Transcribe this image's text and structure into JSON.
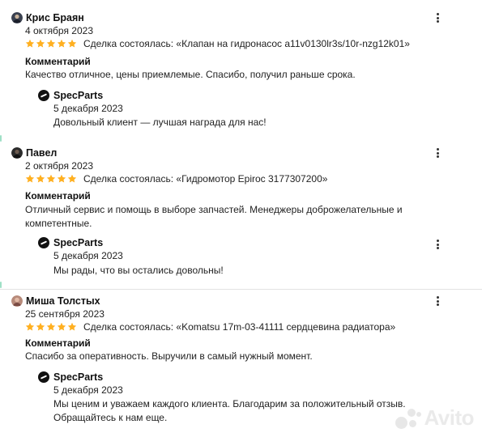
{
  "reviews": [
    {
      "author": "Крис Браян",
      "date": "4 октября 2023",
      "rating": 5,
      "deal": "Сделка состоялась: «Клапан на гидронасос а11v0130lr3s/10r-nzg12k01»",
      "comment_label": "Комментарий",
      "comment": "Качество отличное, цены приемлемые. Спасибо, получил раньше срока.",
      "reply": {
        "author": "SpecParts",
        "date": "5 декабря 2023",
        "text": "Довольный клиент — лучшая награда для нас!"
      }
    },
    {
      "author": "Павел",
      "date": "2 октября 2023",
      "rating": 5,
      "deal": "Сделка состоялась: «Гидромотор Epiroc 3177307200»",
      "comment_label": "Комментарий",
      "comment": "Отличный сервис и помощь в выборе запчастей. Менеджеры доброжелательные и компетентные.",
      "reply": {
        "author": "SpecParts",
        "date": "5 декабря 2023",
        "text": "Мы рады, что вы остались довольны!"
      }
    },
    {
      "author": "Миша Толстых",
      "date": "25 сентября 2023",
      "rating": 5,
      "deal": "Сделка состоялась: «Komatsu 17m-03-41111 сердцевина радиатора»",
      "comment_label": "Комментарий",
      "comment": "Спасибо за оперативность. Выручили в самый нужный момент.",
      "reply": {
        "author": "SpecParts",
        "date": "5 декабря 2023",
        "text": "Мы ценим и уважаем каждого клиента. Благодарим за положительный отзыв. Обращайтесь к нам еще."
      }
    }
  ],
  "watermark": "Avito",
  "colors": {
    "star": "#ffb021",
    "accent_edge": "#9fe0c6"
  }
}
